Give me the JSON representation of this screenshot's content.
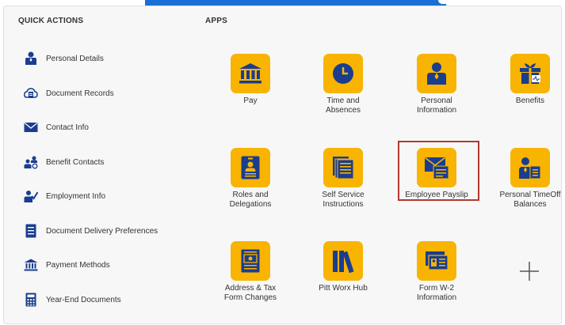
{
  "quick_actions": {
    "title": "QUICK ACTIONS",
    "items": [
      {
        "label": "Personal Details",
        "icon": "person-icon"
      },
      {
        "label": "Document Records",
        "icon": "document-cloud-icon"
      },
      {
        "label": "Contact Info",
        "icon": "envelope-icon"
      },
      {
        "label": "Benefit Contacts",
        "icon": "people-icon"
      },
      {
        "label": "Employment Info",
        "icon": "person-check-icon"
      },
      {
        "label": "Document Delivery Preferences",
        "icon": "document-list-icon"
      },
      {
        "label": "Payment Methods",
        "icon": "bank-icon"
      },
      {
        "label": "Year-End Documents",
        "icon": "calculator-icon"
      }
    ]
  },
  "apps": {
    "title": "APPS",
    "items": [
      {
        "label": "Pay",
        "icon": "bank-icon"
      },
      {
        "label": "Time and\nAbsences",
        "icon": "clock-icon"
      },
      {
        "label": "Personal\nInformation",
        "icon": "person-icon"
      },
      {
        "label": "Benefits",
        "icon": "gift-icon"
      },
      {
        "label": "Roles and\nDelegations",
        "icon": "id-badge-icon"
      },
      {
        "label": "Self Service\nInstructions",
        "icon": "documents-icon"
      },
      {
        "label": "Employee Payslip",
        "icon": "payslip-icon"
      },
      {
        "label": "Personal TimeOff\nBalances",
        "icon": "person-card-icon"
      },
      {
        "label": "Address & Tax\nForm Changes",
        "icon": "tax-form-icon"
      },
      {
        "label": "Pitt Worx Hub",
        "icon": "books-icon"
      },
      {
        "label": "Form W-2\nInformation",
        "icon": "w2-form-icon"
      }
    ]
  },
  "colors": {
    "tile": "#f8b400",
    "icon": "#1a3d8f",
    "highlight": "#b3372e",
    "topbar": "#1a6fd6"
  }
}
